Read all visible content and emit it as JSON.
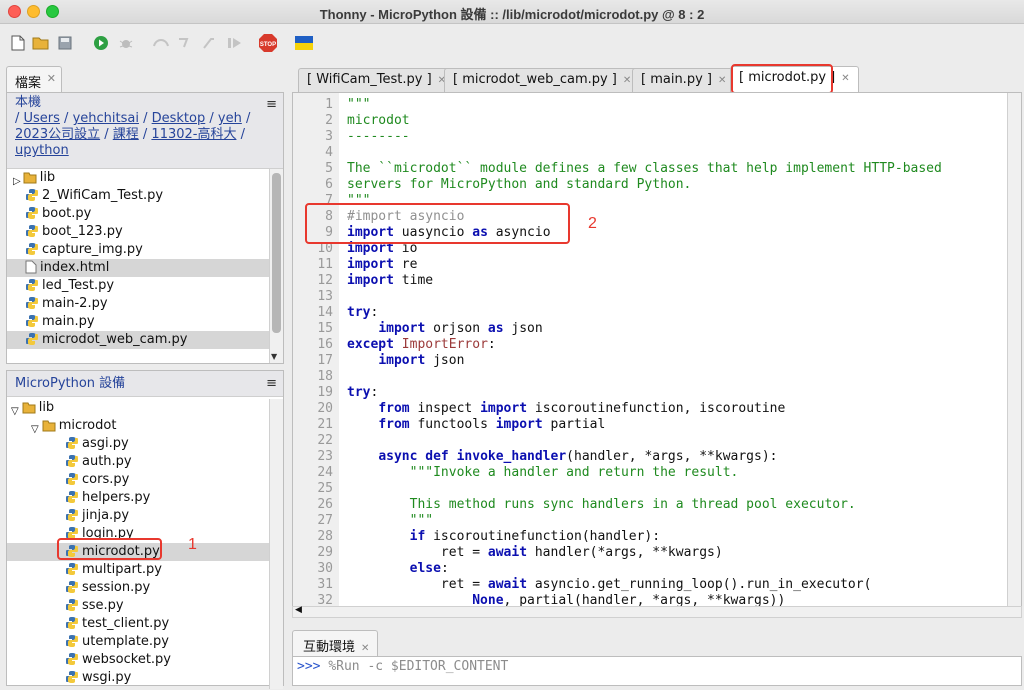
{
  "window": {
    "title": "Thonny  -  MicroPython 設備 :: /lib/microdot/microdot.py  @  8 : 2"
  },
  "toolbar": {
    "icons": [
      "new-file-icon",
      "open-folder-icon",
      "save-icon",
      "run-icon",
      "debug-icon",
      "step-over-icon",
      "step-into-icon",
      "step-out-icon",
      "resume-icon",
      "stop-icon",
      "ukraine-flag-icon"
    ],
    "stop_label": "STOP"
  },
  "files_panel": {
    "tab_label": "檔案",
    "local": {
      "header": "本機",
      "path_segments": [
        "Users",
        "yehchitsai",
        "Desktop",
        "yeh",
        "2023公司設立",
        "課程",
        "11302-高科大",
        "upython"
      ],
      "files": [
        "lib",
        "2_WifiCam_Test.py",
        "boot.py",
        "boot_123.py",
        "capture_img.py",
        "index.html",
        "led_Test.py",
        "main-2.py",
        "main.py",
        "microdot_web_cam.py"
      ]
    },
    "device": {
      "header": "MicroPython 設備",
      "root": "lib",
      "folder": "microdot",
      "files": [
        "asgi.py",
        "auth.py",
        "cors.py",
        "helpers.py",
        "jinja.py",
        "login.py",
        "microdot.py",
        "multipart.py",
        "session.py",
        "sse.py",
        "test_client.py",
        "utemplate.py",
        "websocket.py",
        "wsgi.py"
      ]
    }
  },
  "editor": {
    "tabs": [
      "[ WifiCam_Test.py ]",
      "[ microdot_web_cam.py ]",
      "[ main.py ]",
      "[ microdot.py ]"
    ],
    "active_tab": 3,
    "line_numbers": [
      "1",
      "2",
      "3",
      "4",
      "5",
      "6",
      "7",
      "8",
      "9",
      "10",
      "11",
      "12",
      "13",
      "14",
      "15",
      "16",
      "17",
      "18",
      "19",
      "20",
      "21",
      "22",
      "23",
      "24",
      "25",
      "26",
      "27",
      "28",
      "29",
      "30",
      "31",
      "32"
    ]
  },
  "annotations": {
    "box1": "1",
    "box2": "2"
  },
  "shell": {
    "tab_label": "互動環境",
    "prompt": ">>> ",
    "command": "%Run -c $EDITOR_CONTENT"
  },
  "colors": {
    "highlight": "#e8382e",
    "keyword": "#0b0fb0",
    "string": "#1f8a1f",
    "path_link": "#26449a"
  }
}
